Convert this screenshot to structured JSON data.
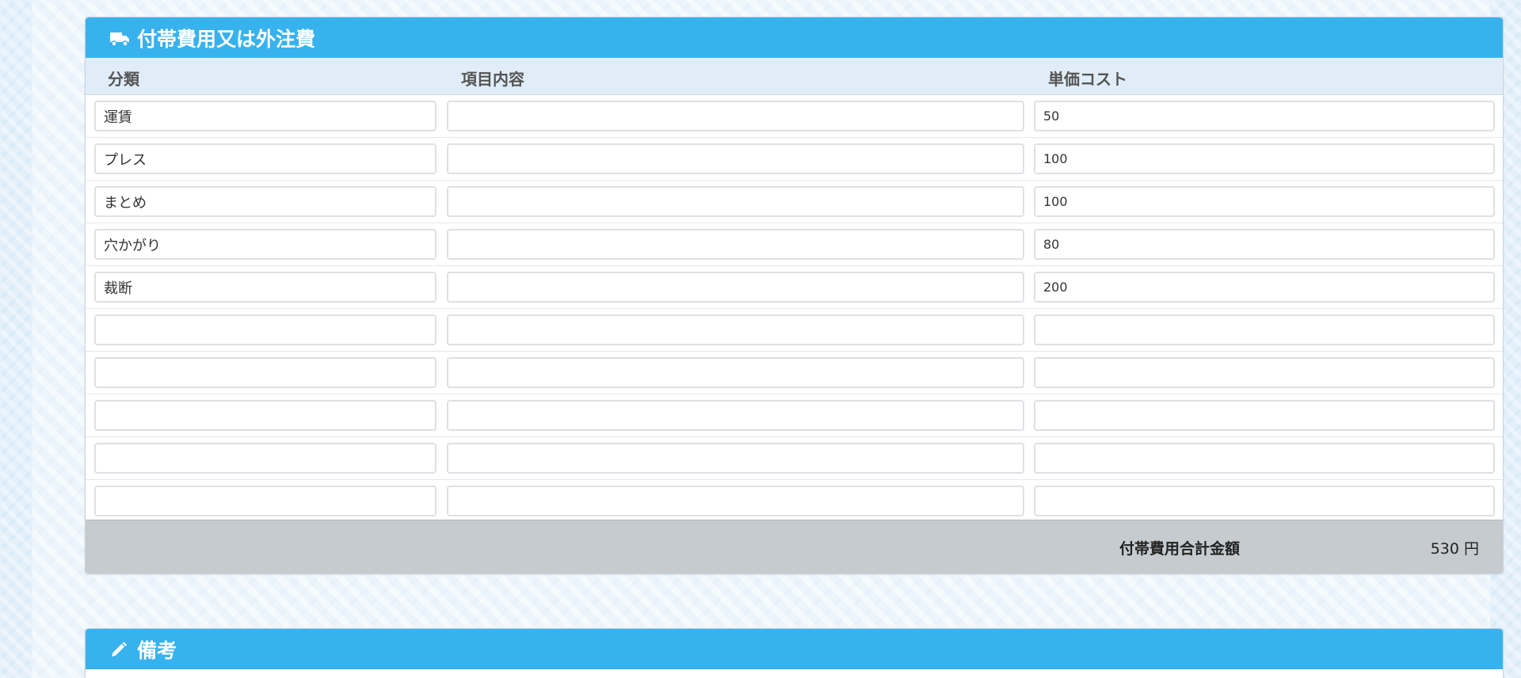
{
  "fees_panel": {
    "title": "付帯費用又は外注費",
    "icon": "truck-icon",
    "columns": {
      "category": "分類",
      "item": "項目内容",
      "unit_cost": "単価コスト"
    },
    "rows": [
      {
        "category": "運賃",
        "item": "",
        "unit_cost": "50"
      },
      {
        "category": "プレス",
        "item": "",
        "unit_cost": "100"
      },
      {
        "category": "まとめ",
        "item": "",
        "unit_cost": "100"
      },
      {
        "category": "穴かがり",
        "item": "",
        "unit_cost": "80"
      },
      {
        "category": "裁断",
        "item": "",
        "unit_cost": "200"
      },
      {
        "category": "",
        "item": "",
        "unit_cost": ""
      },
      {
        "category": "",
        "item": "",
        "unit_cost": ""
      },
      {
        "category": "",
        "item": "",
        "unit_cost": ""
      },
      {
        "category": "",
        "item": "",
        "unit_cost": ""
      },
      {
        "category": "",
        "item": "",
        "unit_cost": ""
      }
    ],
    "total_label": "付帯費用合計金額",
    "total_value": "530 円"
  },
  "notes_panel": {
    "title": "備考",
    "icon": "pencil-icon"
  },
  "colors": {
    "heading_bg": "#38b2ee",
    "column_header_bg": "#e0edf9",
    "footer_bg": "#c5cbce"
  }
}
